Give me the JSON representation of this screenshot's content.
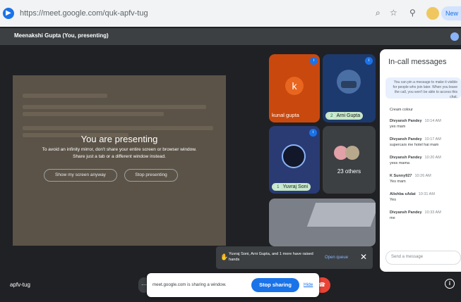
{
  "browser": {
    "url": "https://meet.google.com/quk-apfv-tug",
    "new_label": "New"
  },
  "presenter_strip": {
    "label": "Meenakshi Gupta (You, presenting)"
  },
  "presentation": {
    "title": "You are presenting",
    "subtitle_line1": "To avoid an infinity mirror, don't share your entire screen or browser window.",
    "subtitle_line2": "Share just a tab or a different window instead.",
    "show_anyway": "Show my screen anyway",
    "stop_presenting": "Stop presenting"
  },
  "tiles": {
    "kunal": {
      "initial": "k",
      "name": "kunal gupta",
      "color": "#c9480e"
    },
    "arni": {
      "name": "Arni Gupta",
      "hand_count": "2"
    },
    "yuvraj": {
      "name": "Yuvraj Soni",
      "hand_count": "1"
    },
    "others": {
      "label": "23 others"
    }
  },
  "panel": {
    "title": "In-call messages",
    "note": "You can pin a message to make it visible for people who join later. When you leave the call, you won't be able to access this chat.",
    "messages": [
      {
        "sender": "Cream colour",
        "time": "",
        "text": ""
      },
      {
        "sender": "Divyansh Pandey",
        "time": "10:14 AM",
        "text": "yes mam"
      },
      {
        "sender": "Divyansh Pandey",
        "time": "10:17 AM",
        "text": "supercars me hotel hai mam"
      },
      {
        "sender": "Divyansh Pandey",
        "time": "10:20 AM",
        "text": "yess mama"
      },
      {
        "sender": "K Sunny927",
        "time": "10:26 AM",
        "text": "Yes mam"
      },
      {
        "sender": "Alishba sAdat",
        "time": "10:31 AM",
        "text": "Yes"
      },
      {
        "sender": "Divyansh Pandey",
        "time": "10:33 AM",
        "text": "me"
      }
    ],
    "send_placeholder": "Send a message"
  },
  "toast": {
    "text": "Yuvraj Soni, Arni Gupta, and 1 more have raised hands",
    "link": "Open queue"
  },
  "bottom": {
    "meeting_code": "apfv-tug",
    "sharing_text": "meet.google.com is sharing a window.",
    "stop_sharing": "Stop sharing",
    "hide": "Hide"
  },
  "colors": {
    "accent": "#1a73e8",
    "danger": "#ea4335",
    "background": "#202124"
  }
}
